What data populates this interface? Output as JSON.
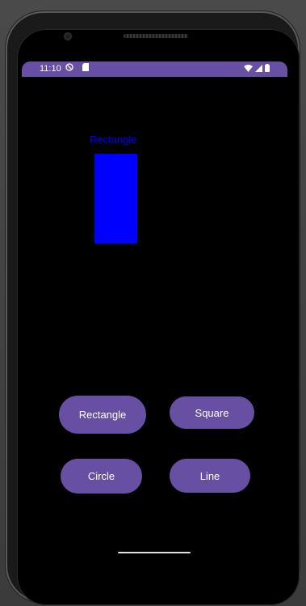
{
  "colors": {
    "accent": "#6750A4",
    "shape": "#0000FF",
    "background": "#000000"
  },
  "status_bar": {
    "time": "11:10",
    "left_icons": [
      "do-not-disturb-icon",
      "sd-card-icon"
    ],
    "right_icons": [
      "wifi-icon",
      "signal-icon",
      "battery-icon"
    ]
  },
  "canvas": {
    "shape_label": "Rectangle",
    "shape_type": "rectangle"
  },
  "buttons": {
    "rectangle": "Rectangle",
    "square": "Square",
    "circle": "Circle",
    "line": "Line"
  }
}
